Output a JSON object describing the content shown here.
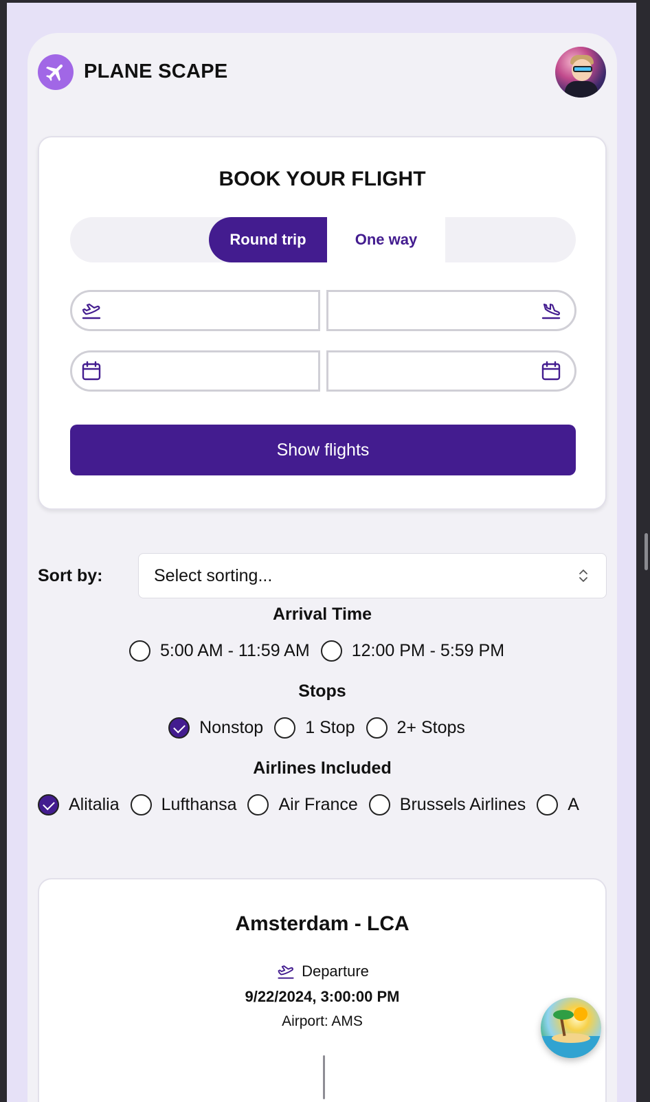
{
  "header": {
    "brand": "PLANE SCAPE",
    "logo_icon": "airplane-icon",
    "avatar_alt": "user-avatar"
  },
  "booking": {
    "title": "BOOK YOUR FLIGHT",
    "trip_types": [
      "Round trip",
      "One way"
    ],
    "selected_trip_type": "Round trip",
    "from_value": "",
    "to_value": "",
    "depart_date_value": "",
    "return_date_value": "",
    "submit_label": "Show flights"
  },
  "sort": {
    "label": "Sort by:",
    "placeholder": "Select sorting..."
  },
  "filters": {
    "arrival_time": {
      "heading": "Arrival Time",
      "options": [
        {
          "label": "5:00 AM - 11:59 AM",
          "checked": false
        },
        {
          "label": "12:00 PM - 5:59 PM",
          "checked": false
        }
      ]
    },
    "stops": {
      "heading": "Stops",
      "options": [
        {
          "label": "Nonstop",
          "checked": true
        },
        {
          "label": "1 Stop",
          "checked": false
        },
        {
          "label": "2+ Stops",
          "checked": false
        }
      ]
    },
    "airlines": {
      "heading": "Airlines Included",
      "options": [
        {
          "label": "Alitalia",
          "checked": true
        },
        {
          "label": "Lufthansa",
          "checked": false
        },
        {
          "label": "Air France",
          "checked": false
        },
        {
          "label": "Brussels Airlines",
          "checked": false
        },
        {
          "label": "A",
          "checked": false
        }
      ]
    }
  },
  "results": [
    {
      "route": "Amsterdam - LCA",
      "departure_label": "Departure",
      "departure_time": "9/22/2024, 3:00:00 PM",
      "airport": "Airport: AMS"
    }
  ],
  "colors": {
    "primary": "#431c8f",
    "accent": "#a167e6",
    "page_bg": "#e6e1f7",
    "app_bg": "#f2f1f6"
  }
}
